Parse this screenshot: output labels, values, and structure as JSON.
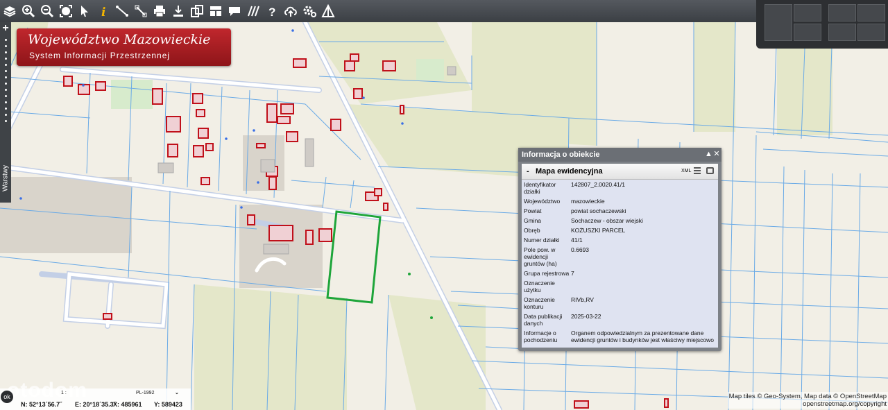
{
  "toolbar": {
    "icons": [
      "layers-icon",
      "zoom-in-icon",
      "zoom-out-icon",
      "zoom-extent-icon",
      "pointer-icon",
      "info-icon",
      "measure-line-icon",
      "measure-link-icon",
      "print-icon",
      "download-icon",
      "copy-icon",
      "layout-icon",
      "comment-icon",
      "hatch-icon",
      "help-icon",
      "cloud-upload-icon",
      "settings-icon",
      "warning-icon"
    ]
  },
  "banner": {
    "title": "Województwo Mazowieckie",
    "subtitle": "System Informacji Przestrzennej"
  },
  "sidebar": {
    "tab_label": "Warstwy"
  },
  "info_window": {
    "title": "Informacja o obiekcie",
    "section": "Mapa ewidencyjna",
    "collapse_symbol": "-",
    "xml_label": "XML",
    "rows": [
      {
        "label": "Identyfikator działki",
        "value": "142807_2.0020.41/1"
      },
      {
        "label": "Województwo",
        "value": "mazowieckie"
      },
      {
        "label": "Powiat",
        "value": "powiat sochaczewski"
      },
      {
        "label": "Gmina",
        "value": "Sochaczew - obszar wiejski"
      },
      {
        "label": "Obręb",
        "value": "KOŻUSZKI PARCEL"
      },
      {
        "label": "Numer działki",
        "value": "41/1"
      },
      {
        "label": "Pole pow. w ewidencji gruntów (ha)",
        "value": "0.6693"
      },
      {
        "label": "Grupa rejestrowa",
        "value": "7"
      },
      {
        "label": "Oznaczenie użytku",
        "value": ""
      },
      {
        "label": "Oznaczenie konturu",
        "value": "RIVb,RV"
      },
      {
        "label": "Data publikacji danych",
        "value": "2025-03-22"
      },
      {
        "label": "Informacje o pochodzeniu",
        "value": "Organem odpowiedzialnym za prezentowane dane ewidencji gruntów i budynków jest właściwy miejscowo"
      }
    ]
  },
  "status": {
    "ok_label": "ok",
    "scale_label": "1 : ",
    "crs": "PL-1992",
    "lat": "N: 52°13´56.7˝",
    "lon": "E: 20°18´35.3˝",
    "x": "X: 485961",
    "y": "Y: 589423",
    "watermark": "otodom"
  },
  "attribution": {
    "line1": "Map tiles © Geo-System, Map data © OpenStreetMap",
    "line2": "openstreetmap.org/copyright"
  },
  "colors": {
    "parcel_highlight": "#1ea53a",
    "building_outline": "#c0101a",
    "parcel_lines": "#5fa4e6",
    "field": "#e6e8cc",
    "banner": "#b0222a"
  }
}
